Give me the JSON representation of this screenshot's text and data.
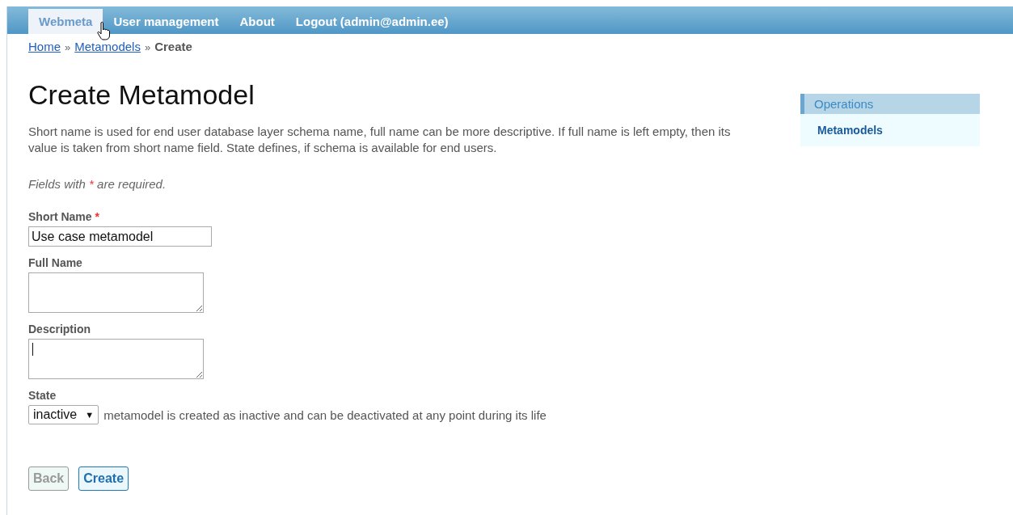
{
  "menu": [
    {
      "label": "Webmeta",
      "selected": true
    },
    {
      "label": "User management",
      "selected": false
    },
    {
      "label": "About",
      "selected": false
    },
    {
      "label": "Logout (admin@admin.ee)",
      "selected": false
    }
  ],
  "breadcrumbs": [
    {
      "label": "Home",
      "kind": "link"
    },
    {
      "label": "»",
      "kind": "separator"
    },
    {
      "label": "Metamodels",
      "kind": "link"
    },
    {
      "label": "»",
      "kind": "separator"
    },
    {
      "label": "Create",
      "kind": "current"
    }
  ],
  "title": "Create Metamodel",
  "intro": "Short name is used for end user database layer schema name, full name can be more descriptive. If full name is left empty, then its value is taken from short name field. State defines, if schema is available for end users.",
  "required_note": {
    "before": "Fields with",
    "mark": "*",
    "after": "are required."
  },
  "fields": [
    {
      "label": "Short Name",
      "required": true,
      "kind": "text",
      "value": "Use case metamodel"
    },
    {
      "label": "Full Name",
      "required": false,
      "kind": "textarea"
    },
    {
      "label": "Description",
      "required": false,
      "kind": "textarea",
      "focused": true
    },
    {
      "label": "State",
      "required": false,
      "kind": "select",
      "value": "inactive",
      "arrow": "▼",
      "hint": "metamodel is created as inactive and can be deactivated at any point during its life"
    }
  ],
  "buttons": [
    {
      "label": "Back",
      "disabled": true
    },
    {
      "label": "Create",
      "disabled": false
    }
  ],
  "sidebar": {
    "title": "Operations",
    "items": [
      "Metamodels"
    ]
  }
}
